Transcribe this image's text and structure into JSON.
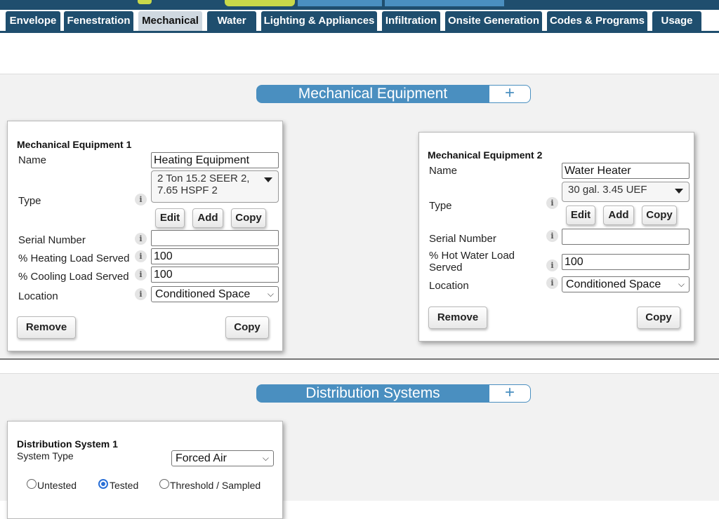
{
  "tabs": [
    "Envelope",
    "Fenestration",
    "Mechanical",
    "Water",
    "Lighting & Appliances",
    "Infiltration",
    "Onsite Generation",
    "Codes & Programs",
    "Usage"
  ],
  "active_tab": "Mechanical",
  "mechanical": {
    "section_title": "Mechanical Equipment",
    "add_symbol": "+",
    "equipment": [
      {
        "title": "Mechanical Equipment 1",
        "name_label": "Name",
        "name_value": "Heating Equipment",
        "type_label": "Type",
        "type_value_line1": "2 Ton 15.2 SEER 2,",
        "type_value_line2": "7.65 HSPF 2",
        "edit_label": "Edit",
        "add_label": "Add",
        "copy_small_label": "Copy",
        "serial_label": "Serial Number",
        "serial_value": "",
        "heating_label": "% Heating Load Served",
        "heating_value": "100",
        "cooling_label": "% Cooling Load Served",
        "cooling_value": "100",
        "location_label": "Location",
        "location_value": "Conditioned Space",
        "remove_label": "Remove",
        "copy_label": "Copy"
      },
      {
        "title": "Mechanical Equipment 2",
        "name_label": "Name",
        "name_value": "Water Heater",
        "type_label": "Type",
        "type_value": "30 gal. 3.45 UEF",
        "edit_label": "Edit",
        "add_label": "Add",
        "copy_small_label": "Copy",
        "serial_label": "Serial Number",
        "serial_value": "",
        "hot_water_label_line1": "% Hot Water Load",
        "hot_water_label_line2": "Served",
        "hot_water_value": "100",
        "location_label": "Location",
        "location_value": "Conditioned Space",
        "remove_label": "Remove",
        "copy_label": "Copy"
      }
    ]
  },
  "distribution": {
    "section_title": "Distribution Systems",
    "add_symbol": "+",
    "systems": [
      {
        "title": "Distribution System 1",
        "system_type_label": "System Type",
        "system_type_value": "Forced Air",
        "radio_options": [
          "Untested",
          "Tested",
          "Threshold / Sampled"
        ],
        "selected_radio": "Tested"
      }
    ]
  },
  "info_glyph": "i",
  "chevron_glyph": "⌵",
  "colors": {
    "nav": "#1f4e6e",
    "accent": "#4a8fc0",
    "active_tab": "#cfd8e0",
    "lime": "#c8d84a"
  }
}
